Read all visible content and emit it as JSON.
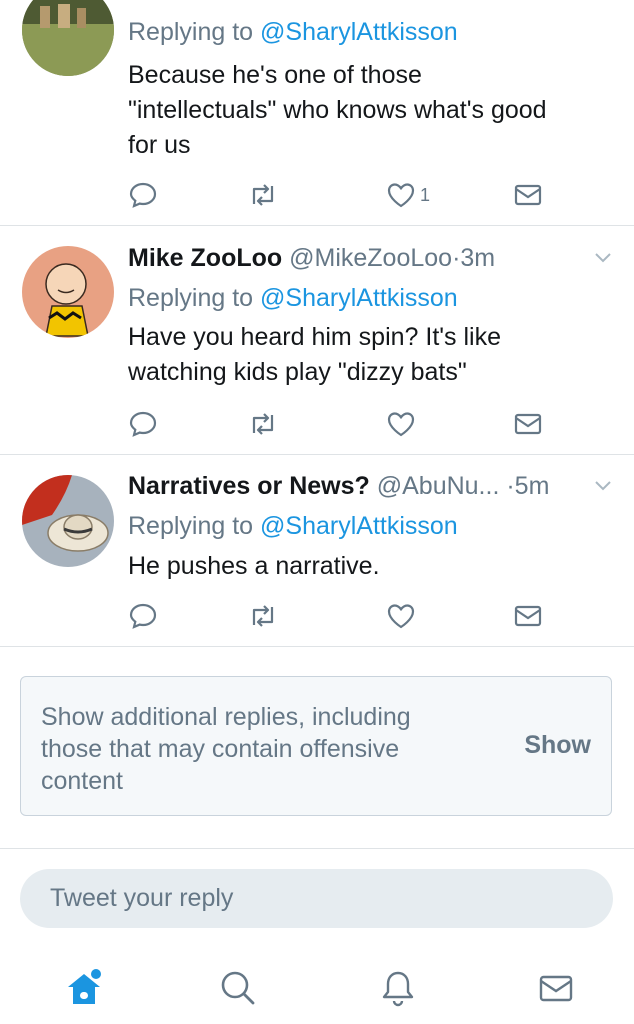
{
  "colors": {
    "accent": "#1b95e0",
    "muted": "#657786",
    "text": "#14171a",
    "border": "#dfe3e6"
  },
  "tweets": [
    {
      "name": "",
      "handle": "",
      "time": "",
      "replying_prefix": "Replying to ",
      "replying_to": "@SharylAttkisson",
      "text": "Because he's one of those \"intellectuals\" who knows what's good for us",
      "like_count": "1",
      "avatar_icon": "landscape-avatar"
    },
    {
      "name": "Mike ZooLoo",
      "handle": "@MikeZooLoo",
      "dot": "·",
      "time": "3m",
      "replying_prefix": "Replying to ",
      "replying_to": "@SharylAttkisson",
      "text": "Have you heard him spin?  It's like watching kids play \"dizzy bats\"",
      "like_count": "",
      "avatar_icon": "charlie-brown-avatar"
    },
    {
      "name": "Narratives or News?",
      "handle": "@AbuNu...",
      "dot": "·",
      "time": "5m",
      "replying_prefix": "Replying to ",
      "replying_to": "@SharylAttkisson",
      "text": "He pushes a narrative.",
      "like_count": "",
      "avatar_icon": "hat-avatar"
    }
  ],
  "action_icons": [
    "reply-icon",
    "retweet-icon",
    "like-icon",
    "dm-icon"
  ],
  "show_more": {
    "text": "Show additional replies, including those that may contain offensive content",
    "button": "Show"
  },
  "reply_box": {
    "placeholder": "Tweet your reply"
  },
  "tabbar": {
    "icons": [
      "home-icon",
      "search-icon",
      "notifications-icon",
      "messages-icon"
    ]
  }
}
